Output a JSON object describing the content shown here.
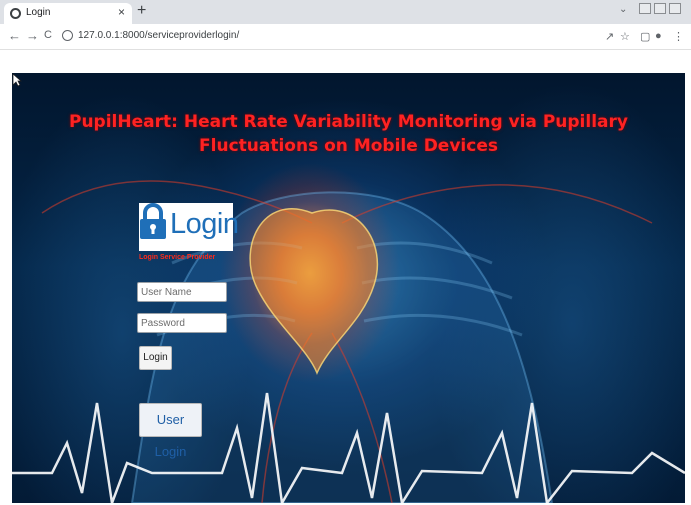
{
  "browser": {
    "tab_title": "Login",
    "tab_close": "×",
    "new_tab": "+",
    "url": "127.0.0.1:8000/serviceproviderlogin/",
    "back": "←",
    "forward": "→",
    "reload": "C",
    "share_icon": "share-icon",
    "bookmark_icon": "star-icon",
    "sidepanel_icon": "side-panel-icon",
    "profile_icon": "profile-icon",
    "menu_icon": "kebab-menu-icon"
  },
  "page": {
    "title": "PupilHeart: Heart Rate Variability Monitoring via Pupillary Fluctuations on Mobile Devices",
    "login_banner": "Login",
    "login_subtitle": "Login Service Provider",
    "username_placeholder": "User Name",
    "password_placeholder": "Password",
    "login_button": "Login",
    "user_login_button": "User Login"
  },
  "colors": {
    "title": "#ff2222",
    "banner_text": "#1f6fb8",
    "subtitle": "#ff2a1a",
    "hero_background": "#042648"
  }
}
